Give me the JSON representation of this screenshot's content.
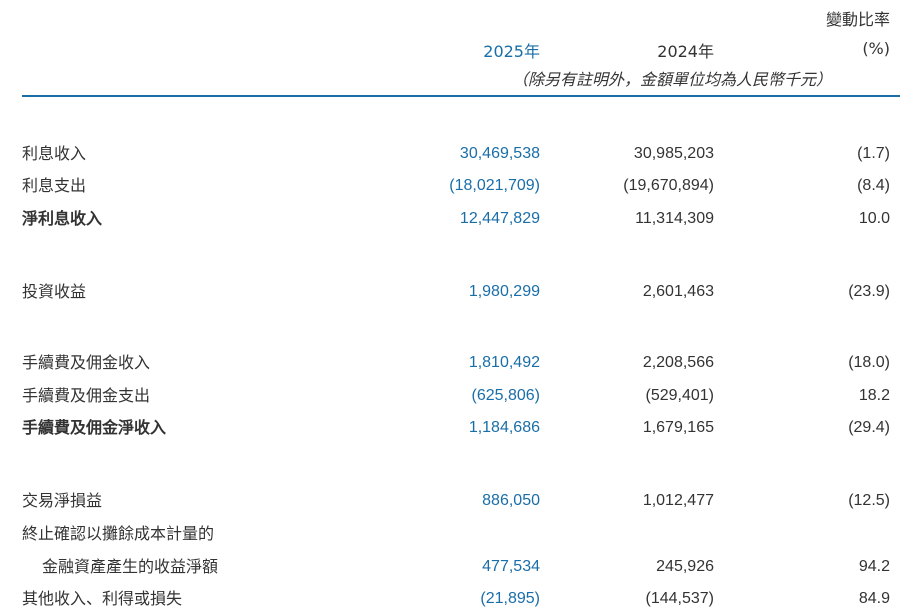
{
  "header": {
    "change_rate_label": "變動比率",
    "year_2025": "2025年",
    "year_2024": "2024年",
    "pct_unit": "(%)",
    "note": "（除另有註明外，金額單位均為人民幣千元）"
  },
  "colors": {
    "accent": "#1a6ea8",
    "text": "#333333"
  },
  "rows": [
    {
      "label": "利息收入",
      "y2025": "30,469,538",
      "y2024": "30,985,203",
      "change": "(1.7)",
      "bold": false
    },
    {
      "label": "利息支出",
      "y2025": "(18,021,709)",
      "y2024": "(19,670,894)",
      "change": "(8.4)",
      "bold": false
    },
    {
      "label": "淨利息收入",
      "y2025": "12,447,829",
      "y2024": "11,314,309",
      "change": "10.0",
      "bold": true
    },
    {
      "label": "投資收益",
      "y2025": "1,980,299",
      "y2024": "2,601,463",
      "change": "(23.9)",
      "bold": false
    },
    {
      "label": "手續費及佣金收入",
      "y2025": "1,810,492",
      "y2024": "2,208,566",
      "change": "(18.0)",
      "bold": false
    },
    {
      "label": "手續費及佣金支出",
      "y2025": "(625,806)",
      "y2024": "(529,401)",
      "change": "18.2",
      "bold": false
    },
    {
      "label": "手續費及佣金淨收入",
      "y2025": "1,184,686",
      "y2024": "1,679,165",
      "change": "(29.4)",
      "bold": true
    },
    {
      "label": "交易淨損益",
      "y2025": "886,050",
      "y2024": "1,012,477",
      "change": "(12.5)",
      "bold": false
    },
    {
      "label": "終止確認以攤餘成本計量的",
      "label2": "金融資產產生的收益淨額",
      "y2025": "477,534",
      "y2024": "245,926",
      "change": "94.2",
      "bold": false
    },
    {
      "label": "其他收入、利得或損失",
      "y2025": "(21,895)",
      "y2024": "(144,537)",
      "change": "84.9",
      "bold": false
    }
  ]
}
